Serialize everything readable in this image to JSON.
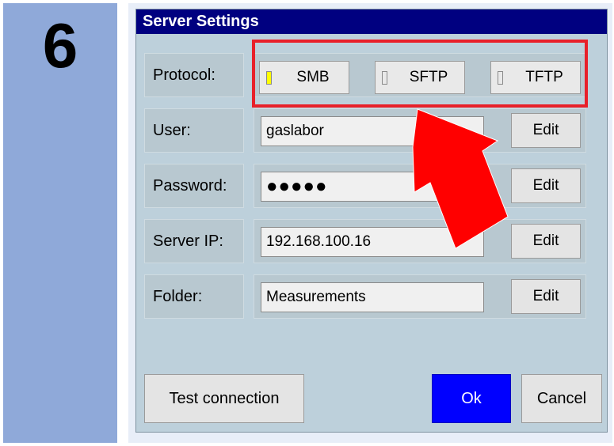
{
  "step": {
    "number": "6"
  },
  "dialog": {
    "title": "Server Settings",
    "protocol": {
      "label": "Protocol:",
      "options": [
        {
          "label": "SMB",
          "selected": true
        },
        {
          "label": "SFTP",
          "selected": false
        },
        {
          "label": "TFTP",
          "selected": false
        }
      ]
    },
    "user": {
      "label": "User:",
      "value": "gaslabor",
      "edit": "Edit"
    },
    "password": {
      "label": "Password:",
      "value": "●●●●●",
      "edit": "Edit"
    },
    "server_ip": {
      "label": "Server IP:",
      "value": "192.168.100.16",
      "edit": "Edit"
    },
    "folder": {
      "label": "Folder:",
      "value": "Measurements",
      "edit": "Edit"
    },
    "buttons": {
      "test": "Test connection",
      "ok": "Ok",
      "cancel": "Cancel"
    }
  },
  "colors": {
    "titlebar": "#000080",
    "ok_button": "#0000ff",
    "annotation": "#ff0000",
    "step_panel": "#8fa9d9",
    "selected_indicator": "#ffff00"
  }
}
